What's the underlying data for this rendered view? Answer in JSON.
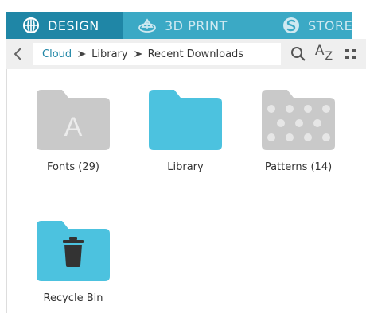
{
  "tabs": [
    {
      "label": "DESIGN",
      "icon": "globe-icon",
      "active": true
    },
    {
      "label": "3D PRINT",
      "icon": "3d-print-icon",
      "active": false
    },
    {
      "label": "STORE",
      "icon": "store-logo-icon",
      "active": false
    }
  ],
  "breadcrumb": [
    "Cloud",
    "Library",
    "Recent Downloads"
  ],
  "toolbar": {
    "back_icon": "chevron-left-icon",
    "search_icon": "search-icon",
    "sort_icon": "sort-az-icon",
    "sort_a": "A",
    "sort_z": "Z",
    "grid_icon": "grid-view-icon"
  },
  "folders": [
    {
      "label": "Fonts (29)",
      "icon": "fonts-folder-icon",
      "glyph": "A",
      "color": "#c9c9c9"
    },
    {
      "label": "Library",
      "icon": "library-folder-icon",
      "color": "#4cc2df"
    },
    {
      "label": "Patterns (14)",
      "icon": "patterns-folder-icon",
      "color": "#c9c9c9"
    },
    {
      "label": "Recycle Bin",
      "icon": "trash-icon",
      "color": "#4cc2df"
    }
  ],
  "colors": {
    "tabbar": "#3ba9c5",
    "tab_active": "#1f86a6",
    "folder_blue": "#4cc2df",
    "folder_grey": "#c9c9c9"
  }
}
